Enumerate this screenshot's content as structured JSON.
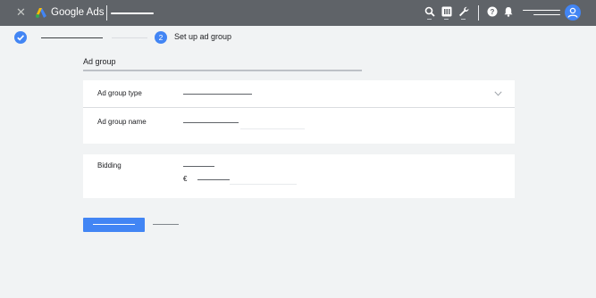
{
  "topbar": {
    "brand": "Google Ads",
    "icons": [
      "close-icon",
      "google-ads-logo",
      "search-icon",
      "reports-icon",
      "tools-icon",
      "help-icon",
      "notifications-icon",
      "account-avatar"
    ]
  },
  "stepper": {
    "step2_number": "2",
    "step2_label": "Set up ad group"
  },
  "section": {
    "title": "Ad group"
  },
  "form": {
    "ad_group_type_label": "Ad group type",
    "ad_group_name_label": "Ad group name",
    "bidding_label": "Bidding",
    "currency_symbol": "€"
  },
  "colors": {
    "topbar": "#5f6368",
    "accent": "#4285f4",
    "background": "#f1f3f4",
    "card": "#ffffff"
  }
}
